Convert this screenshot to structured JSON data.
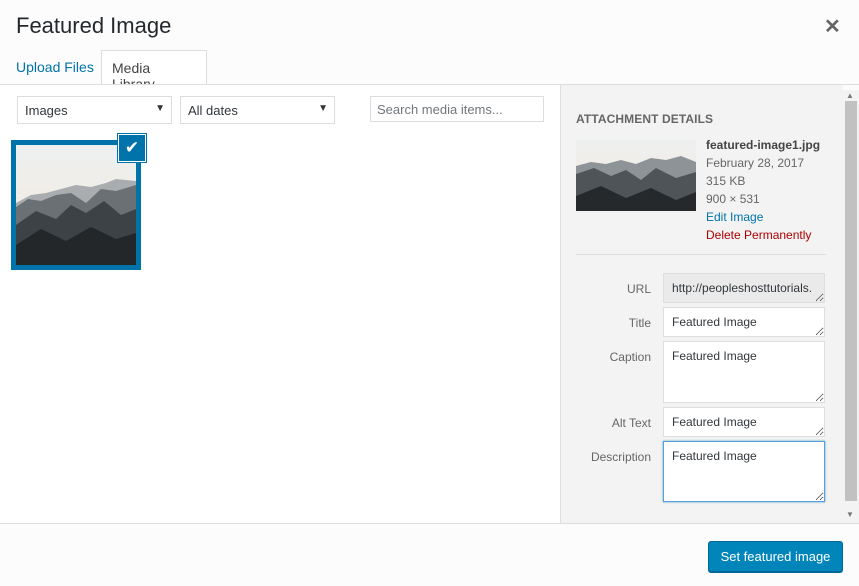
{
  "modal": {
    "title": "Featured Image",
    "close_icon": "close-icon"
  },
  "tabs": [
    {
      "label": "Upload Files",
      "active": false
    },
    {
      "label": "Media Library",
      "active": true
    }
  ],
  "toolbar": {
    "type_filter": "Images",
    "date_filter": "All dates",
    "search_placeholder": "Search media items..."
  },
  "library": {
    "items": [
      {
        "selected": true
      }
    ]
  },
  "details": {
    "heading": "ATTACHMENT DETAILS",
    "filename": "featured-image1.jpg",
    "date": "February 28, 2017",
    "size": "315 KB",
    "dimensions": "900 × 531",
    "edit_link": "Edit Image",
    "delete_link": "Delete Permanently",
    "fields": {
      "url": {
        "label": "URL",
        "value": "http://peopleshosttutorials."
      },
      "title": {
        "label": "Title",
        "value": "Featured Image"
      },
      "caption": {
        "label": "Caption",
        "value": "Featured Image"
      },
      "alt": {
        "label": "Alt Text",
        "value": "Featured Image"
      },
      "description": {
        "label": "Description",
        "value": "Featured Image"
      }
    }
  },
  "footer": {
    "primary_button": "Set featured image"
  },
  "colors": {
    "accent": "#0073aa",
    "button": "#0085ba",
    "delete": "#a00"
  }
}
